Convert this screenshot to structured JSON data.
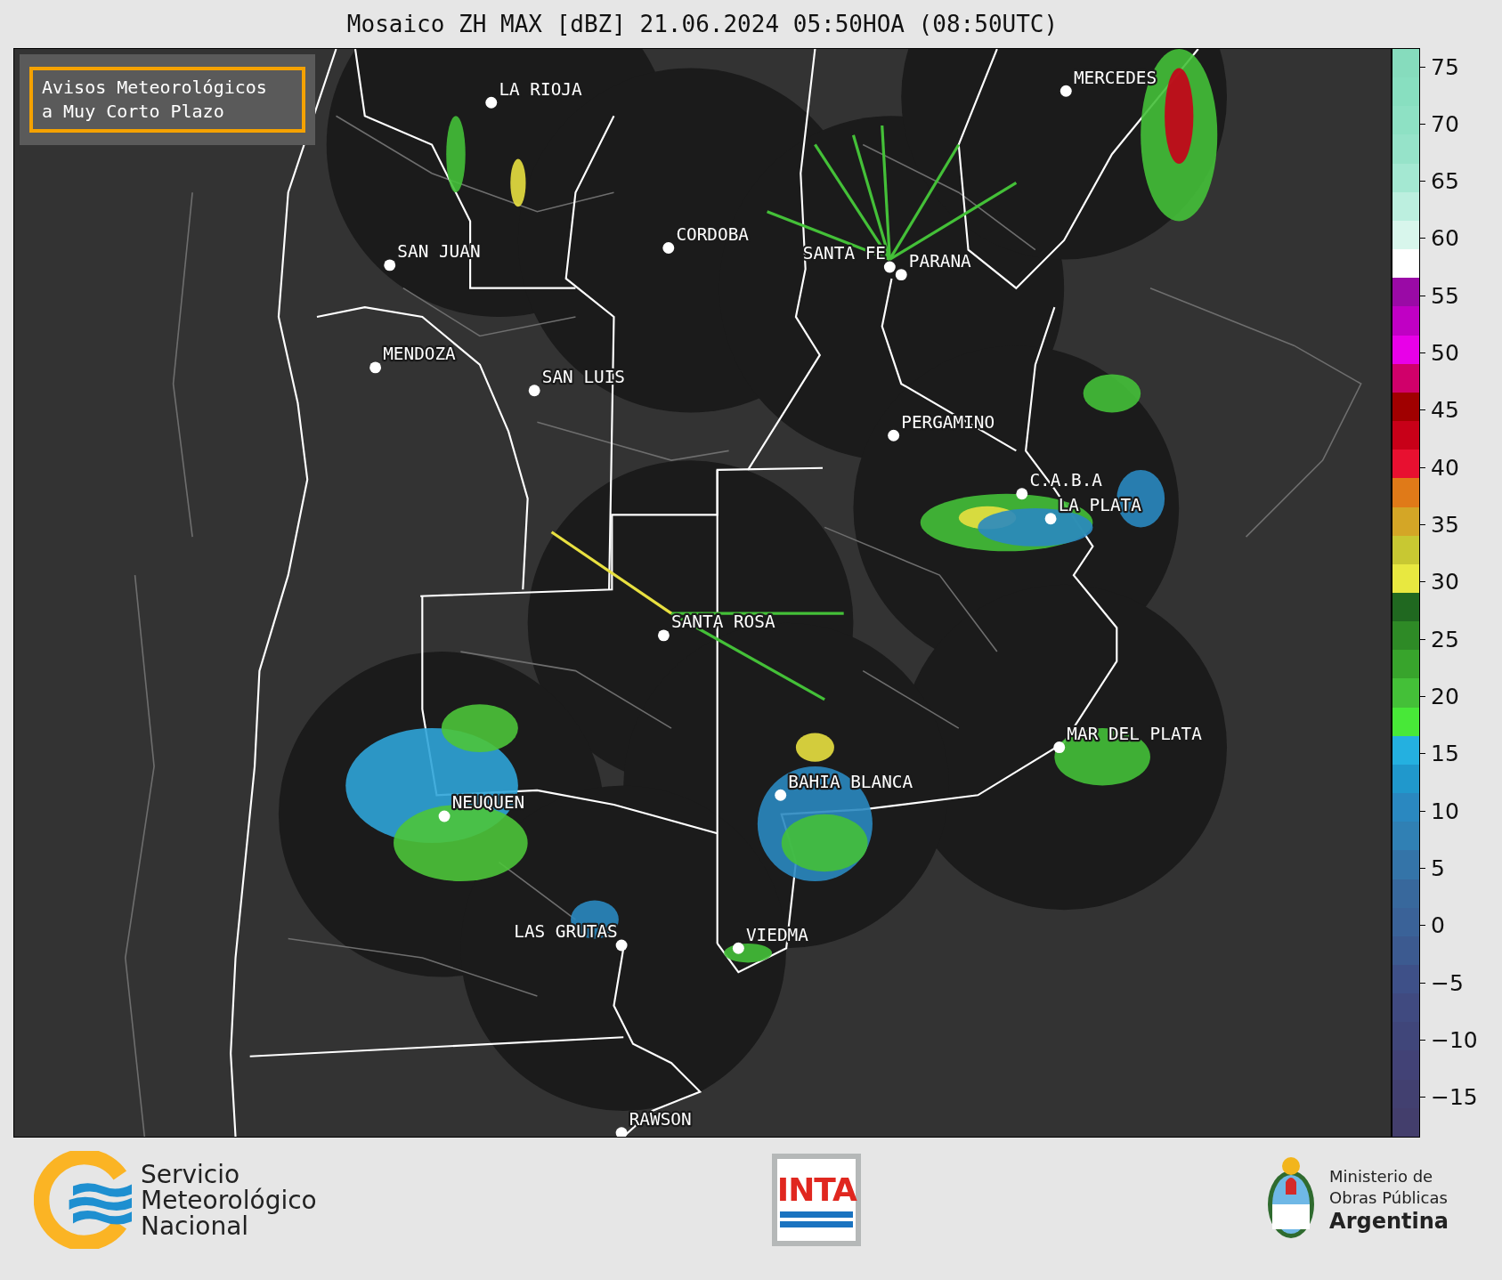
{
  "title": "Mosaico ZH MAX [dBZ] 21.06.2024 05:50HOA (08:50UTC)",
  "legend_box": {
    "text": "Avisos Meteorológicos\na Muy Corto Plazo"
  },
  "cities": [
    {
      "name": "LA RIOJA"
    },
    {
      "name": "MERCEDES"
    },
    {
      "name": "CORDOBA"
    },
    {
      "name": "SAN JUAN"
    },
    {
      "name": "SANTA FE"
    },
    {
      "name": "PARANA"
    },
    {
      "name": "MENDOZA"
    },
    {
      "name": "SAN LUIS"
    },
    {
      "name": "PERGAMINO"
    },
    {
      "name": "C.A.B.A"
    },
    {
      "name": "LA PLATA"
    },
    {
      "name": "SANTA ROSA"
    },
    {
      "name": "MAR DEL PLATA"
    },
    {
      "name": "BAHIA BLANCA"
    },
    {
      "name": "NEUQUEN"
    },
    {
      "name": "LAS GRUTAS"
    },
    {
      "name": "VIEDMA"
    },
    {
      "name": "RAWSON"
    }
  ],
  "colorbar": {
    "ticks": [
      "75",
      "70",
      "65",
      "60",
      "55",
      "50",
      "45",
      "40",
      "35",
      "30",
      "25",
      "20",
      "15",
      "10",
      "5",
      "0",
      "−5",
      "−10",
      "−15"
    ],
    "segments": [
      {
        "color": "#86dcbd"
      },
      {
        "color": "#88dfc0"
      },
      {
        "color": "#8ee1c4"
      },
      {
        "color": "#96e3c9"
      },
      {
        "color": "#a4e8d2"
      },
      {
        "color": "#bcefdf"
      },
      {
        "color": "#d8f6ec"
      },
      {
        "color": "#ffffff"
      },
      {
        "color": "#9a0aa6"
      },
      {
        "color": "#c000c4"
      },
      {
        "color": "#e800e8"
      },
      {
        "color": "#d0006a"
      },
      {
        "color": "#a00000"
      },
      {
        "color": "#c80018"
      },
      {
        "color": "#e81030"
      },
      {
        "color": "#e07a18"
      },
      {
        "color": "#d4a626"
      },
      {
        "color": "#c8c832"
      },
      {
        "color": "#e8e840"
      },
      {
        "color": "#206820"
      },
      {
        "color": "#2e8a26"
      },
      {
        "color": "#38a42c"
      },
      {
        "color": "#44c038"
      },
      {
        "color": "#48e838"
      },
      {
        "color": "#24b0e0"
      },
      {
        "color": "#2098cc"
      },
      {
        "color": "#2a88c0"
      },
      {
        "color": "#3080b4"
      },
      {
        "color": "#3474a8"
      },
      {
        "color": "#38689c"
      },
      {
        "color": "#3a6298"
      },
      {
        "color": "#3c5a90"
      },
      {
        "color": "#3e5088"
      },
      {
        "color": "#404a80"
      },
      {
        "color": "#40467a"
      },
      {
        "color": "#424276"
      },
      {
        "color": "#424070"
      },
      {
        "color": "#433e6c"
      }
    ]
  },
  "footer": {
    "smn": {
      "text": "Servicio\nMeteorológico\nNacional"
    },
    "inta": {
      "text": "INTA"
    },
    "ministry": {
      "line1": "Ministerio de\nObras Públicas",
      "line2": "Argentina"
    }
  }
}
